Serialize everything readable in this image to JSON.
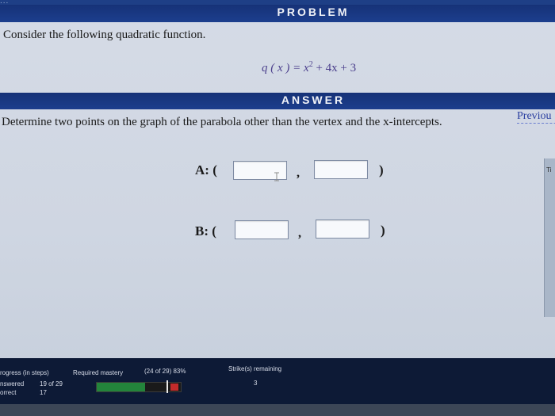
{
  "top_strip": {
    "text": "..."
  },
  "problem": {
    "header": "PROBLEM",
    "prompt": "Consider the following quadratic function.",
    "equation": {
      "lhs": "q ( x ) = x",
      "exponent": "2",
      "rhs": " + 4x + 3"
    }
  },
  "answer": {
    "header": "ANSWER",
    "instruction": "Determine two points on the graph of the parabola other than the vertex and the x-intercepts.",
    "previous_label": "Previou",
    "side_tab_label": "Ti",
    "rows": [
      {
        "label": "A: (",
        "comma": ",",
        "close": ")",
        "x_value": "",
        "y_value": ""
      },
      {
        "label": "B: (",
        "comma": ",",
        "close": ")",
        "x_value": "",
        "y_value": ""
      }
    ]
  },
  "status": {
    "progress_label": "rogress (in steps)",
    "mastery_label": "Required mastery",
    "mastery_detail": "(24 of 29) 83%",
    "answered_label": "nswered",
    "answered_value": "19 of 29",
    "correct_label": "orrect",
    "correct_value": "17",
    "strikes_label": "Strike(s) remaining",
    "strikes_value": "3",
    "progress_fraction": 0.58,
    "mastery_fraction": 0.83,
    "colors": {
      "fill": "#23843b",
      "strike": "#c32b2b",
      "header": "#1c3e8d"
    }
  }
}
